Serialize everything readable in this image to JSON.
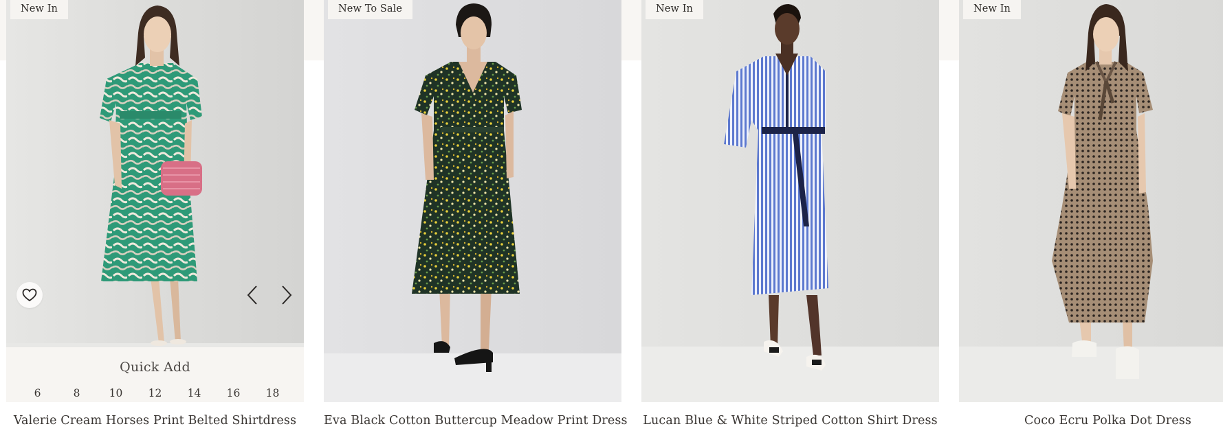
{
  "products": [
    {
      "badge": "New In",
      "title": "Valerie Cream Horses Print Belted Shirtdress",
      "image": "model wearing green horse-print belted shirtdress holding pink clutch",
      "favorite_icon": "heart-icon",
      "prev_icon": "chevron-left-icon",
      "next_icon": "chevron-right-icon",
      "quick_add": "Quick Add",
      "sizes": [
        "6",
        "8",
        "10",
        "12",
        "14",
        "16",
        "18"
      ]
    },
    {
      "badge": "New To Sale",
      "title": "Eva Black Cotton Buttercup Meadow Print Dress",
      "image": "model wearing black floral cotton midi dress with black Mary Jane shoes"
    },
    {
      "badge": "New In",
      "title": "Lucan Blue & White Striped Cotton Shirt Dress",
      "image": "model wearing blue and white striped shirt dress with white heels"
    },
    {
      "badge": "New In",
      "title": "Coco Ecru Polka Dot Dress",
      "image": "model wearing ecru polka dot tiered midi dress with white trainers"
    }
  ],
  "colors": {
    "background": "#ffffff",
    "top_band": "#f8f6f3",
    "badge_bg": "#f6f4f1",
    "text": "#3a3633"
  }
}
